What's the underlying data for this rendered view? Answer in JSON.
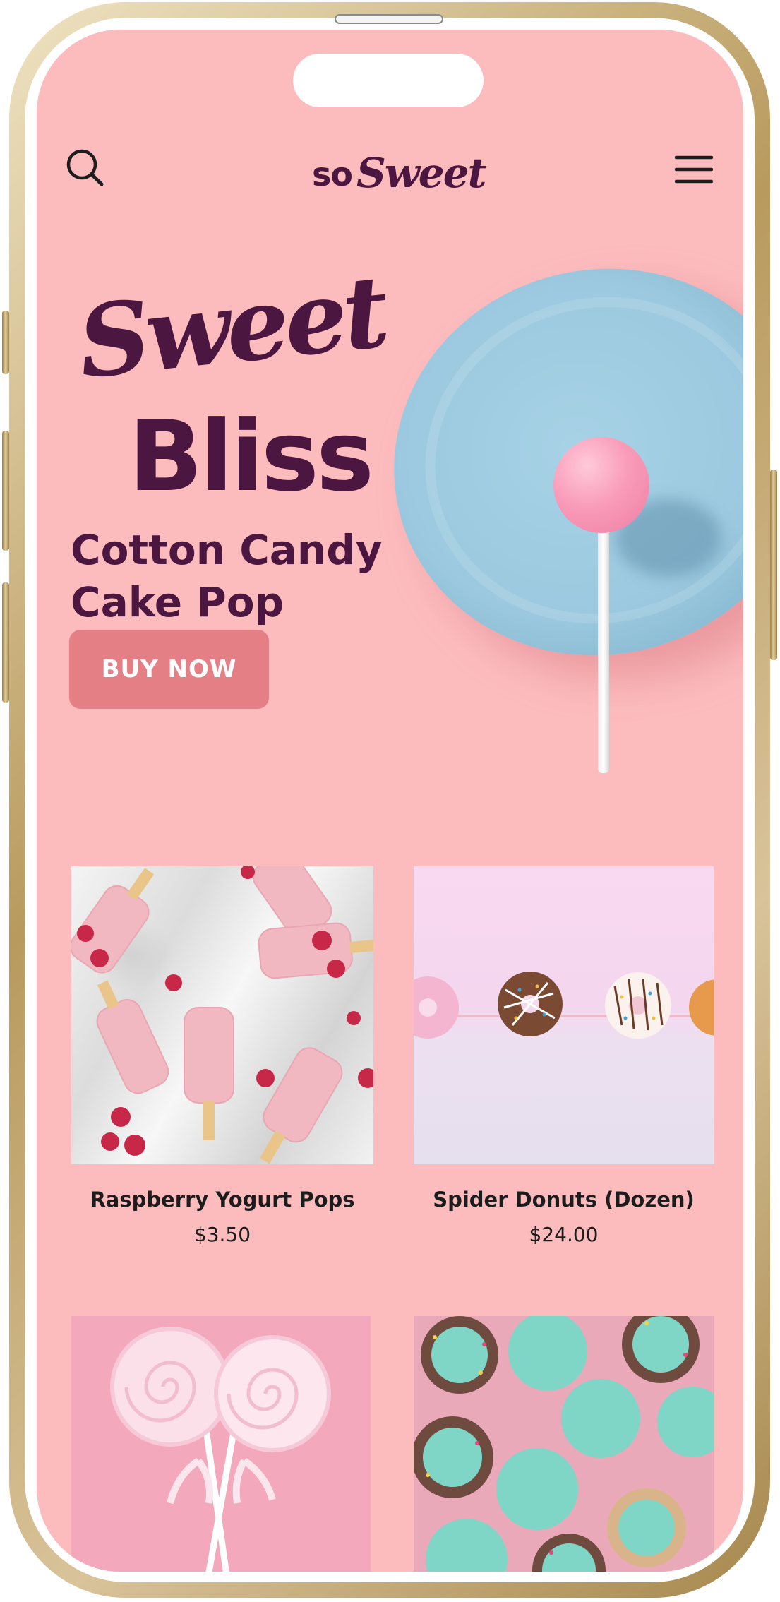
{
  "app": {
    "brand_so": "so",
    "brand_sweet": "Sweet"
  },
  "hero": {
    "script_title": "Sweet",
    "block_title": "Bliss",
    "product_name": "Cotton Candy Cake Pop",
    "cta_label": "BUY NOW"
  },
  "products": [
    {
      "name": "Raspberry Yogurt Pops",
      "price": "$3.50"
    },
    {
      "name": "Spider Donuts (Dozen)",
      "price": "$24.00"
    },
    {
      "name": "",
      "price": ""
    },
    {
      "name": "",
      "price": ""
    }
  ],
  "colors": {
    "background": "#fcbcbe",
    "brand": "#4b163f",
    "cta": "#e57f86"
  },
  "icons": {
    "search": "search-icon",
    "menu": "hamburger-menu-icon"
  }
}
